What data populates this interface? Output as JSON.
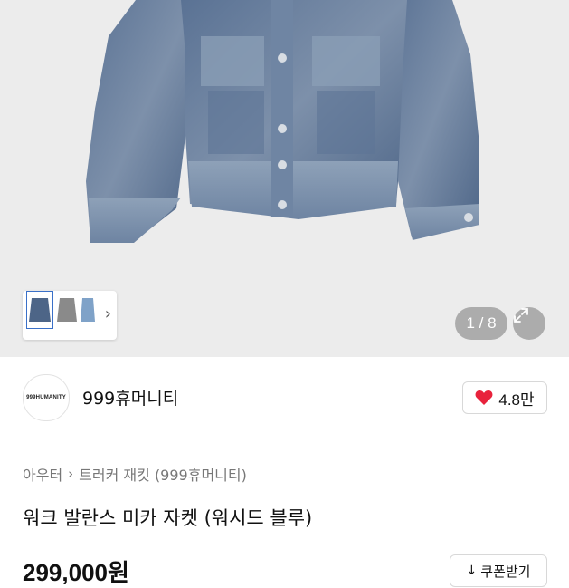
{
  "gallery": {
    "counter": "1 / 8",
    "thumbnail_icons": [
      "jacket-front-thumb",
      "jacket-gray-thumb",
      "jacket-light-thumb"
    ],
    "next_icon": "chevron-right-icon",
    "expand_icon": "expand-icon"
  },
  "brand": {
    "logo_text": "999HUMANITY",
    "name": "999휴머니티",
    "likes": "4.8만",
    "like_icon": "heart-icon",
    "heart_color": "#e8223c"
  },
  "breadcrumb": {
    "category": "아우터",
    "subcategory": "트러커 재킷 (999휴머니티)"
  },
  "product": {
    "title": "워크 발란스 미카 자켓 (워시드 블루)",
    "price": "299,000원",
    "coupon_label": "쿠폰받기"
  }
}
